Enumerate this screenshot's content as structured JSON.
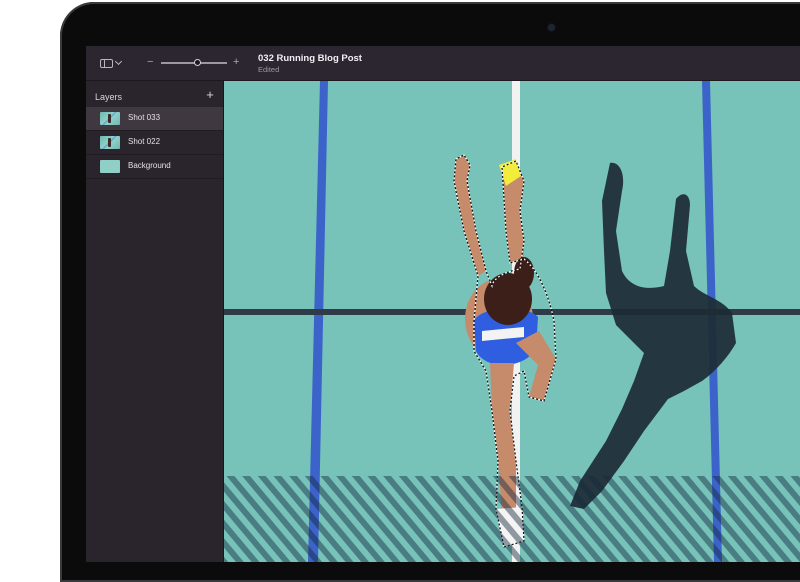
{
  "document": {
    "title": "032 Running Blog Post",
    "status": "Edited"
  },
  "toolbar": {
    "zoom_minus": "−",
    "zoom_plus": "+",
    "zoom_level": 0.55
  },
  "sidebar": {
    "header": "Layers",
    "add_label": "+",
    "layers": [
      {
        "name": "Shot 033",
        "thumbnail": "photo",
        "selected": true
      },
      {
        "name": "Shot 022",
        "thumbnail": "photo",
        "selected": false
      },
      {
        "name": "Background",
        "thumbnail": "solid",
        "selected": false
      }
    ]
  },
  "colors": {
    "track": "#77c2b9",
    "lane_blue": "#3b63c9",
    "lane_white": "#f2f2f2",
    "sidebar_bg": "#2a242c",
    "selected_row": "#3f3841"
  },
  "icons": [
    "sidebar-toggle-icon",
    "chevron-down-icon",
    "plus-icon"
  ]
}
